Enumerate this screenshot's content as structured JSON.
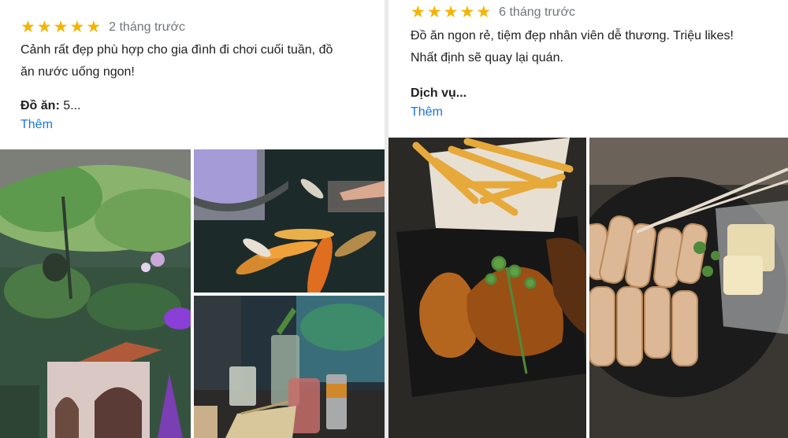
{
  "reviews": [
    {
      "rating": 5,
      "stars": [
        "★",
        "★",
        "★",
        "★",
        "★"
      ],
      "date": "2 tháng trước",
      "text_lines": [
        "Cảnh rất đẹp phù hợp cho gia đình đi chơi cuối tuần, đồ",
        "ăn nước uống ngon!"
      ],
      "aspect_label": "Đồ ăn:",
      "aspect_value": "5...",
      "more_label": "Thêm",
      "photos": [
        "photo-garden-terrace",
        "photo-koi-pond",
        "photo-drinks-table"
      ]
    },
    {
      "rating": 5,
      "stars": [
        "★",
        "★",
        "★",
        "★",
        "★"
      ],
      "date": "6 tháng trước",
      "text_lines": [
        "Đồ ăn ngon rẻ, tiệm đẹp nhân viên dễ thương. Triệu likes!",
        "Nhất định sẽ quay lại quán."
      ],
      "aspect_label": "Dịch vụ...",
      "more_label": "Thêm",
      "photos": [
        "photo-chicken-fries",
        "photo-spring-rolls"
      ]
    }
  ],
  "colors": {
    "star": "#f4b400",
    "link": "#1a73e8",
    "date": "#70757a",
    "text": "#202124"
  }
}
